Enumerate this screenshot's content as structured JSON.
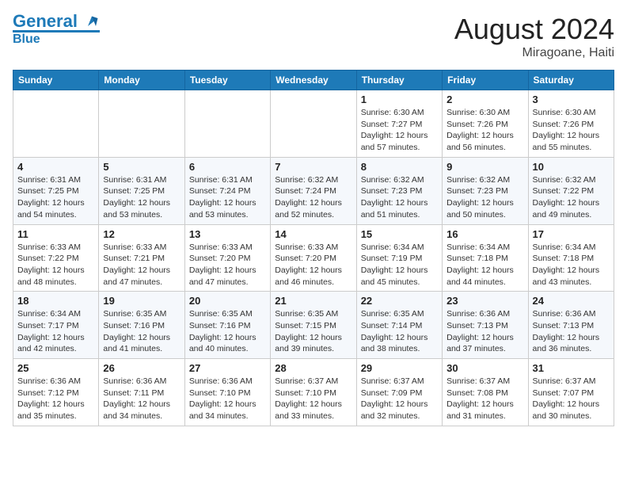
{
  "header": {
    "logo_general": "General",
    "logo_blue": "Blue",
    "month_year": "August 2024",
    "location": "Miragoane, Haiti"
  },
  "weekdays": [
    "Sunday",
    "Monday",
    "Tuesday",
    "Wednesday",
    "Thursday",
    "Friday",
    "Saturday"
  ],
  "weeks": [
    [
      {
        "day": "",
        "info": ""
      },
      {
        "day": "",
        "info": ""
      },
      {
        "day": "",
        "info": ""
      },
      {
        "day": "",
        "info": ""
      },
      {
        "day": "1",
        "info": "Sunrise: 6:30 AM\nSunset: 7:27 PM\nDaylight: 12 hours and 57 minutes."
      },
      {
        "day": "2",
        "info": "Sunrise: 6:30 AM\nSunset: 7:26 PM\nDaylight: 12 hours and 56 minutes."
      },
      {
        "day": "3",
        "info": "Sunrise: 6:30 AM\nSunset: 7:26 PM\nDaylight: 12 hours and 55 minutes."
      }
    ],
    [
      {
        "day": "4",
        "info": "Sunrise: 6:31 AM\nSunset: 7:25 PM\nDaylight: 12 hours and 54 minutes."
      },
      {
        "day": "5",
        "info": "Sunrise: 6:31 AM\nSunset: 7:25 PM\nDaylight: 12 hours and 53 minutes."
      },
      {
        "day": "6",
        "info": "Sunrise: 6:31 AM\nSunset: 7:24 PM\nDaylight: 12 hours and 53 minutes."
      },
      {
        "day": "7",
        "info": "Sunrise: 6:32 AM\nSunset: 7:24 PM\nDaylight: 12 hours and 52 minutes."
      },
      {
        "day": "8",
        "info": "Sunrise: 6:32 AM\nSunset: 7:23 PM\nDaylight: 12 hours and 51 minutes."
      },
      {
        "day": "9",
        "info": "Sunrise: 6:32 AM\nSunset: 7:23 PM\nDaylight: 12 hours and 50 minutes."
      },
      {
        "day": "10",
        "info": "Sunrise: 6:32 AM\nSunset: 7:22 PM\nDaylight: 12 hours and 49 minutes."
      }
    ],
    [
      {
        "day": "11",
        "info": "Sunrise: 6:33 AM\nSunset: 7:22 PM\nDaylight: 12 hours and 48 minutes."
      },
      {
        "day": "12",
        "info": "Sunrise: 6:33 AM\nSunset: 7:21 PM\nDaylight: 12 hours and 47 minutes."
      },
      {
        "day": "13",
        "info": "Sunrise: 6:33 AM\nSunset: 7:20 PM\nDaylight: 12 hours and 47 minutes."
      },
      {
        "day": "14",
        "info": "Sunrise: 6:33 AM\nSunset: 7:20 PM\nDaylight: 12 hours and 46 minutes."
      },
      {
        "day": "15",
        "info": "Sunrise: 6:34 AM\nSunset: 7:19 PM\nDaylight: 12 hours and 45 minutes."
      },
      {
        "day": "16",
        "info": "Sunrise: 6:34 AM\nSunset: 7:18 PM\nDaylight: 12 hours and 44 minutes."
      },
      {
        "day": "17",
        "info": "Sunrise: 6:34 AM\nSunset: 7:18 PM\nDaylight: 12 hours and 43 minutes."
      }
    ],
    [
      {
        "day": "18",
        "info": "Sunrise: 6:34 AM\nSunset: 7:17 PM\nDaylight: 12 hours and 42 minutes."
      },
      {
        "day": "19",
        "info": "Sunrise: 6:35 AM\nSunset: 7:16 PM\nDaylight: 12 hours and 41 minutes."
      },
      {
        "day": "20",
        "info": "Sunrise: 6:35 AM\nSunset: 7:16 PM\nDaylight: 12 hours and 40 minutes."
      },
      {
        "day": "21",
        "info": "Sunrise: 6:35 AM\nSunset: 7:15 PM\nDaylight: 12 hours and 39 minutes."
      },
      {
        "day": "22",
        "info": "Sunrise: 6:35 AM\nSunset: 7:14 PM\nDaylight: 12 hours and 38 minutes."
      },
      {
        "day": "23",
        "info": "Sunrise: 6:36 AM\nSunset: 7:13 PM\nDaylight: 12 hours and 37 minutes."
      },
      {
        "day": "24",
        "info": "Sunrise: 6:36 AM\nSunset: 7:13 PM\nDaylight: 12 hours and 36 minutes."
      }
    ],
    [
      {
        "day": "25",
        "info": "Sunrise: 6:36 AM\nSunset: 7:12 PM\nDaylight: 12 hours and 35 minutes."
      },
      {
        "day": "26",
        "info": "Sunrise: 6:36 AM\nSunset: 7:11 PM\nDaylight: 12 hours and 34 minutes."
      },
      {
        "day": "27",
        "info": "Sunrise: 6:36 AM\nSunset: 7:10 PM\nDaylight: 12 hours and 34 minutes."
      },
      {
        "day": "28",
        "info": "Sunrise: 6:37 AM\nSunset: 7:10 PM\nDaylight: 12 hours and 33 minutes."
      },
      {
        "day": "29",
        "info": "Sunrise: 6:37 AM\nSunset: 7:09 PM\nDaylight: 12 hours and 32 minutes."
      },
      {
        "day": "30",
        "info": "Sunrise: 6:37 AM\nSunset: 7:08 PM\nDaylight: 12 hours and 31 minutes."
      },
      {
        "day": "31",
        "info": "Sunrise: 6:37 AM\nSunset: 7:07 PM\nDaylight: 12 hours and 30 minutes."
      }
    ]
  ]
}
